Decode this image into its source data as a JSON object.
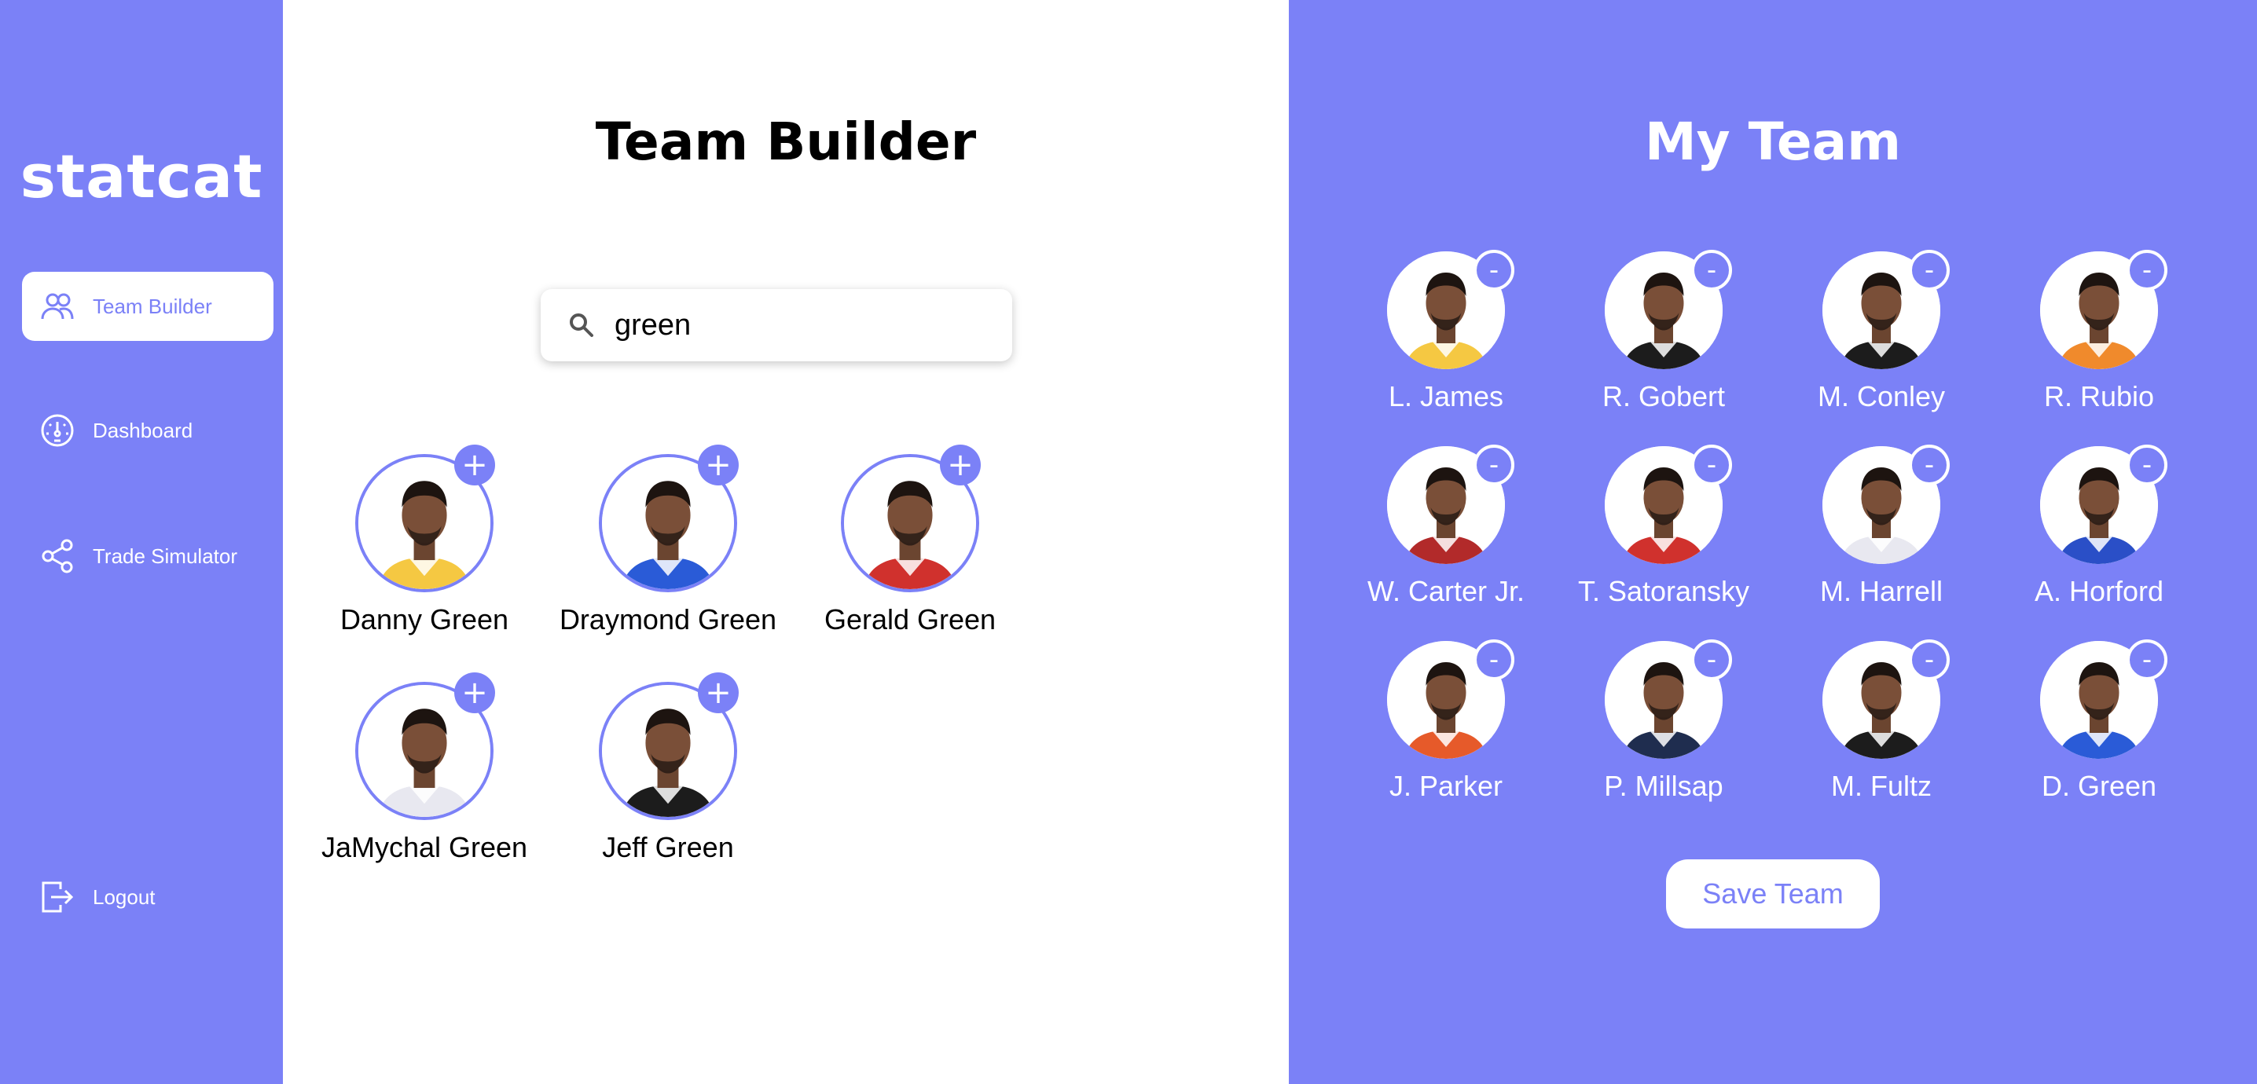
{
  "sidebar": {
    "logo": "statcat",
    "nav": [
      {
        "label": "Team Builder",
        "icon": "users-icon",
        "active": true
      },
      {
        "label": "Dashboard",
        "icon": "gauge-icon",
        "active": false
      },
      {
        "label": "Trade Simulator",
        "icon": "share-icon",
        "active": false
      }
    ],
    "logout": {
      "label": "Logout",
      "icon": "logout-icon"
    }
  },
  "builder": {
    "title": "Team Builder",
    "search": {
      "value": "green",
      "icon": "search-icon"
    },
    "add_symbol": "+",
    "results": [
      {
        "name": "Danny Green",
        "jersey": "#f5c842"
      },
      {
        "name": "Draymond Green",
        "jersey": "#2a5bd7"
      },
      {
        "name": "Gerald Green",
        "jersey": "#d0312d"
      },
      {
        "name": "JaMychal Green",
        "jersey": "#e8e8f0"
      },
      {
        "name": "Jeff Green",
        "jersey": "#1c1c1c"
      }
    ]
  },
  "team": {
    "title": "My Team",
    "remove_symbol": "-",
    "players": [
      {
        "name": "L. James",
        "jersey": "#f5c842"
      },
      {
        "name": "R. Gobert",
        "jersey": "#1c1c1c"
      },
      {
        "name": "M. Conley",
        "jersey": "#1c1c1c"
      },
      {
        "name": "R. Rubio",
        "jersey": "#f08a2c"
      },
      {
        "name": "W. Carter Jr.",
        "jersey": "#b22a2a"
      },
      {
        "name": "T. Satoransky",
        "jersey": "#d0312d"
      },
      {
        "name": "M. Harrell",
        "jersey": "#e8e8f0"
      },
      {
        "name": "A. Horford",
        "jersey": "#2a4fc7"
      },
      {
        "name": "J. Parker",
        "jersey": "#e65a2a"
      },
      {
        "name": "P. Millsap",
        "jersey": "#1f2d4f"
      },
      {
        "name": "M. Fultz",
        "jersey": "#1c1c1c"
      },
      {
        "name": "D. Green",
        "jersey": "#2a5bd7"
      }
    ],
    "save_label": "Save Team"
  }
}
